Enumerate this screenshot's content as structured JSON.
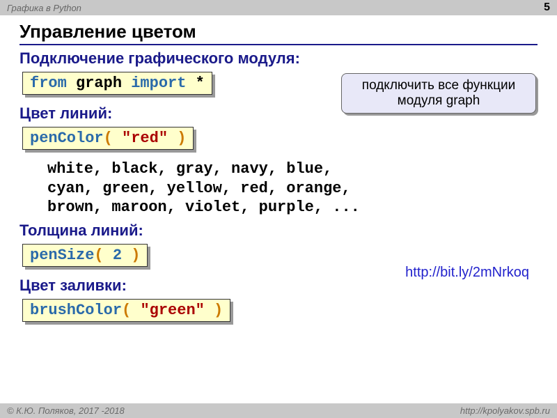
{
  "header": {
    "course": "Графика в Python",
    "page": "5"
  },
  "title": "Управление цветом",
  "sections": {
    "import": {
      "label": "Подключение графического модуля:",
      "code": {
        "kw1": "from",
        "mod": " graph ",
        "kw2": "import",
        "star": " *"
      }
    },
    "penColor": {
      "label": "Цвет линий:",
      "code": {
        "fn": "penColor",
        "lp": "( ",
        "arg": "\"red\"",
        "rp": " )"
      }
    },
    "colorList": "white, black, gray, navy, blue,\ncyan, green, yellow, red, orange,\nbrown, maroon, violet, purple, ...",
    "penSize": {
      "label": "Толщина линий:",
      "code": {
        "fn": "penSize",
        "lp": "( ",
        "arg": "2",
        "rp": " )"
      }
    },
    "brushColor": {
      "label": "Цвет заливки:",
      "code": {
        "fn": "brushColor",
        "lp": "( ",
        "arg": "\"green\"",
        "rp": " )"
      }
    }
  },
  "callout": "подключить все\nфункции модуля graph",
  "link": "http://bit.ly/2mNrkoq",
  "footer": {
    "left": "© К.Ю. Поляков, 2017 -2018",
    "right": "http://kpolyakov.spb.ru"
  }
}
